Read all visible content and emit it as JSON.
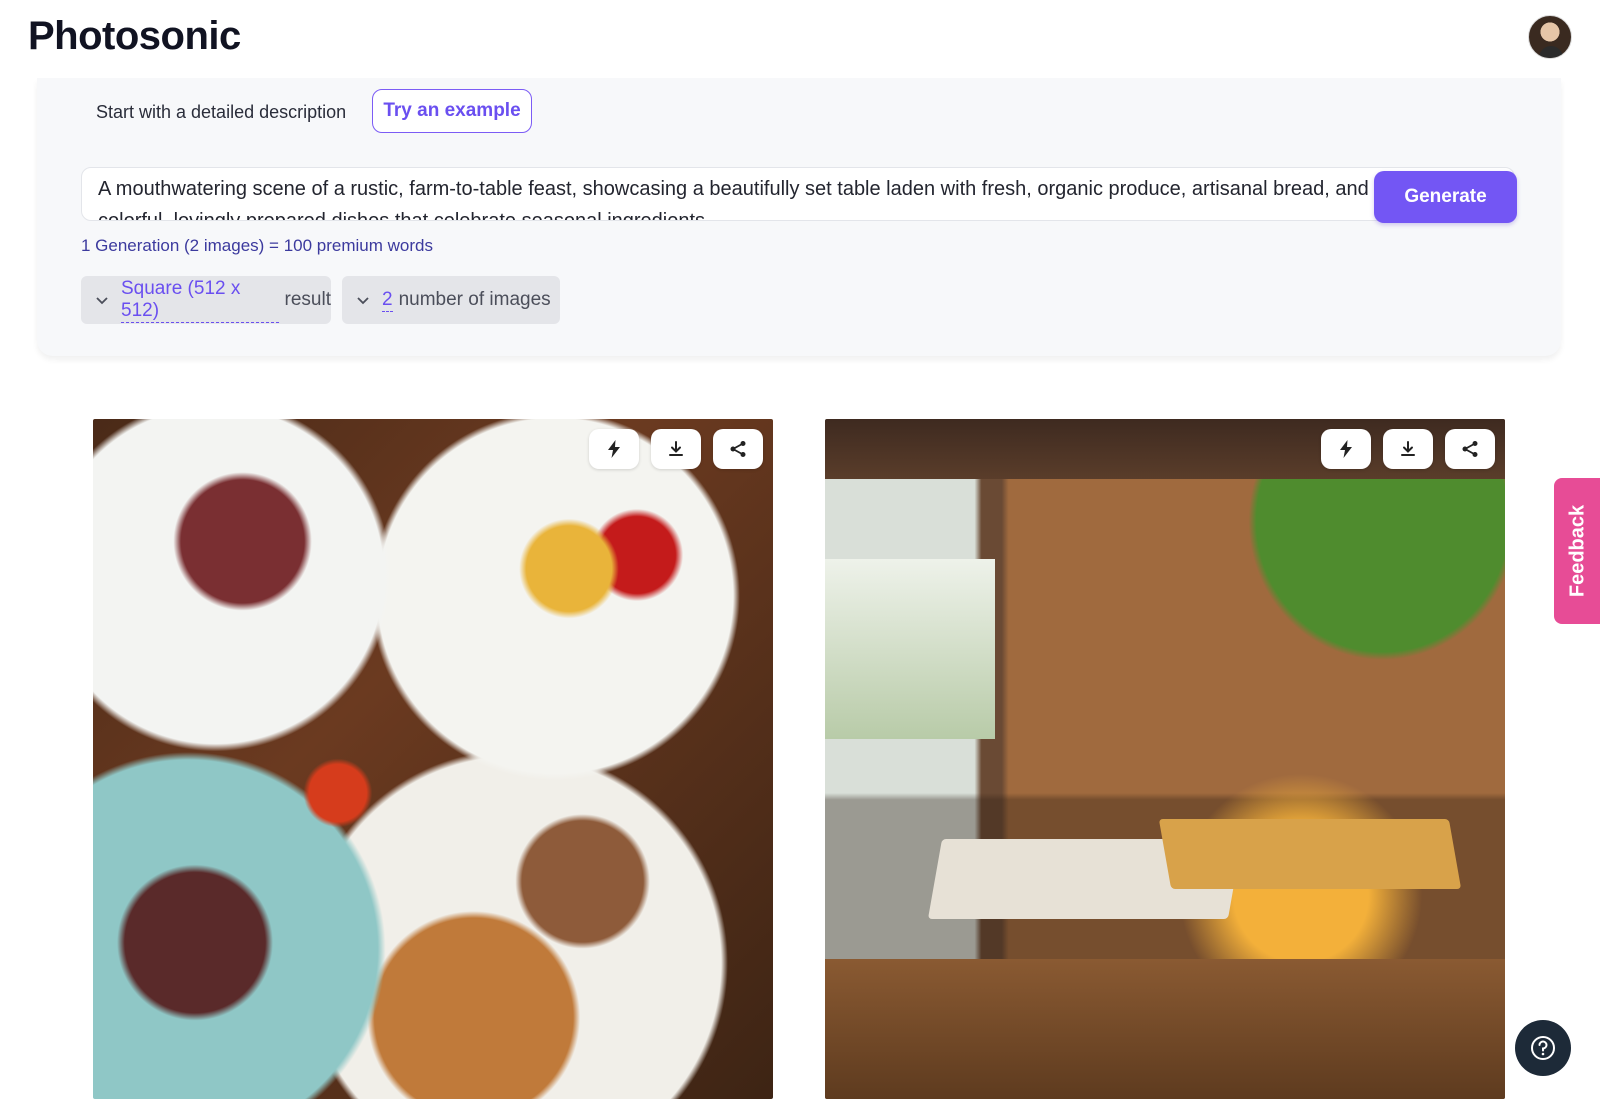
{
  "header": {
    "logo": "Photosonic"
  },
  "prompt_panel": {
    "hint": "Start with a detailed description",
    "try_example_label": "Try an example",
    "prompt_value": "A mouthwatering scene of a rustic, farm-to-table feast, showcasing a beautifully set table laden with fresh, organic produce, artisanal bread, and a variety of colorful, lovingly prepared dishes that celebrate seasonal ingredients.",
    "generate_label": "Generate",
    "cost_note": "1 Generation (2 images) = 100 premium words"
  },
  "options": {
    "size_value": "Square (512 x 512)",
    "size_suffix": "result",
    "count_value": "2",
    "count_suffix": "number of images"
  },
  "images": [
    {
      "name": "generated-image-1",
      "actions": [
        "bolt-icon",
        "download-icon",
        "share-icon"
      ]
    },
    {
      "name": "generated-image-2",
      "actions": [
        "bolt-icon",
        "download-icon",
        "share-icon"
      ]
    }
  ],
  "feedback_label": "Feedback",
  "colors": {
    "accent": "#7356f4",
    "feedback": "#e74c96",
    "help_button": "#1d2a38",
    "cost_text": "#3c3a9e"
  }
}
